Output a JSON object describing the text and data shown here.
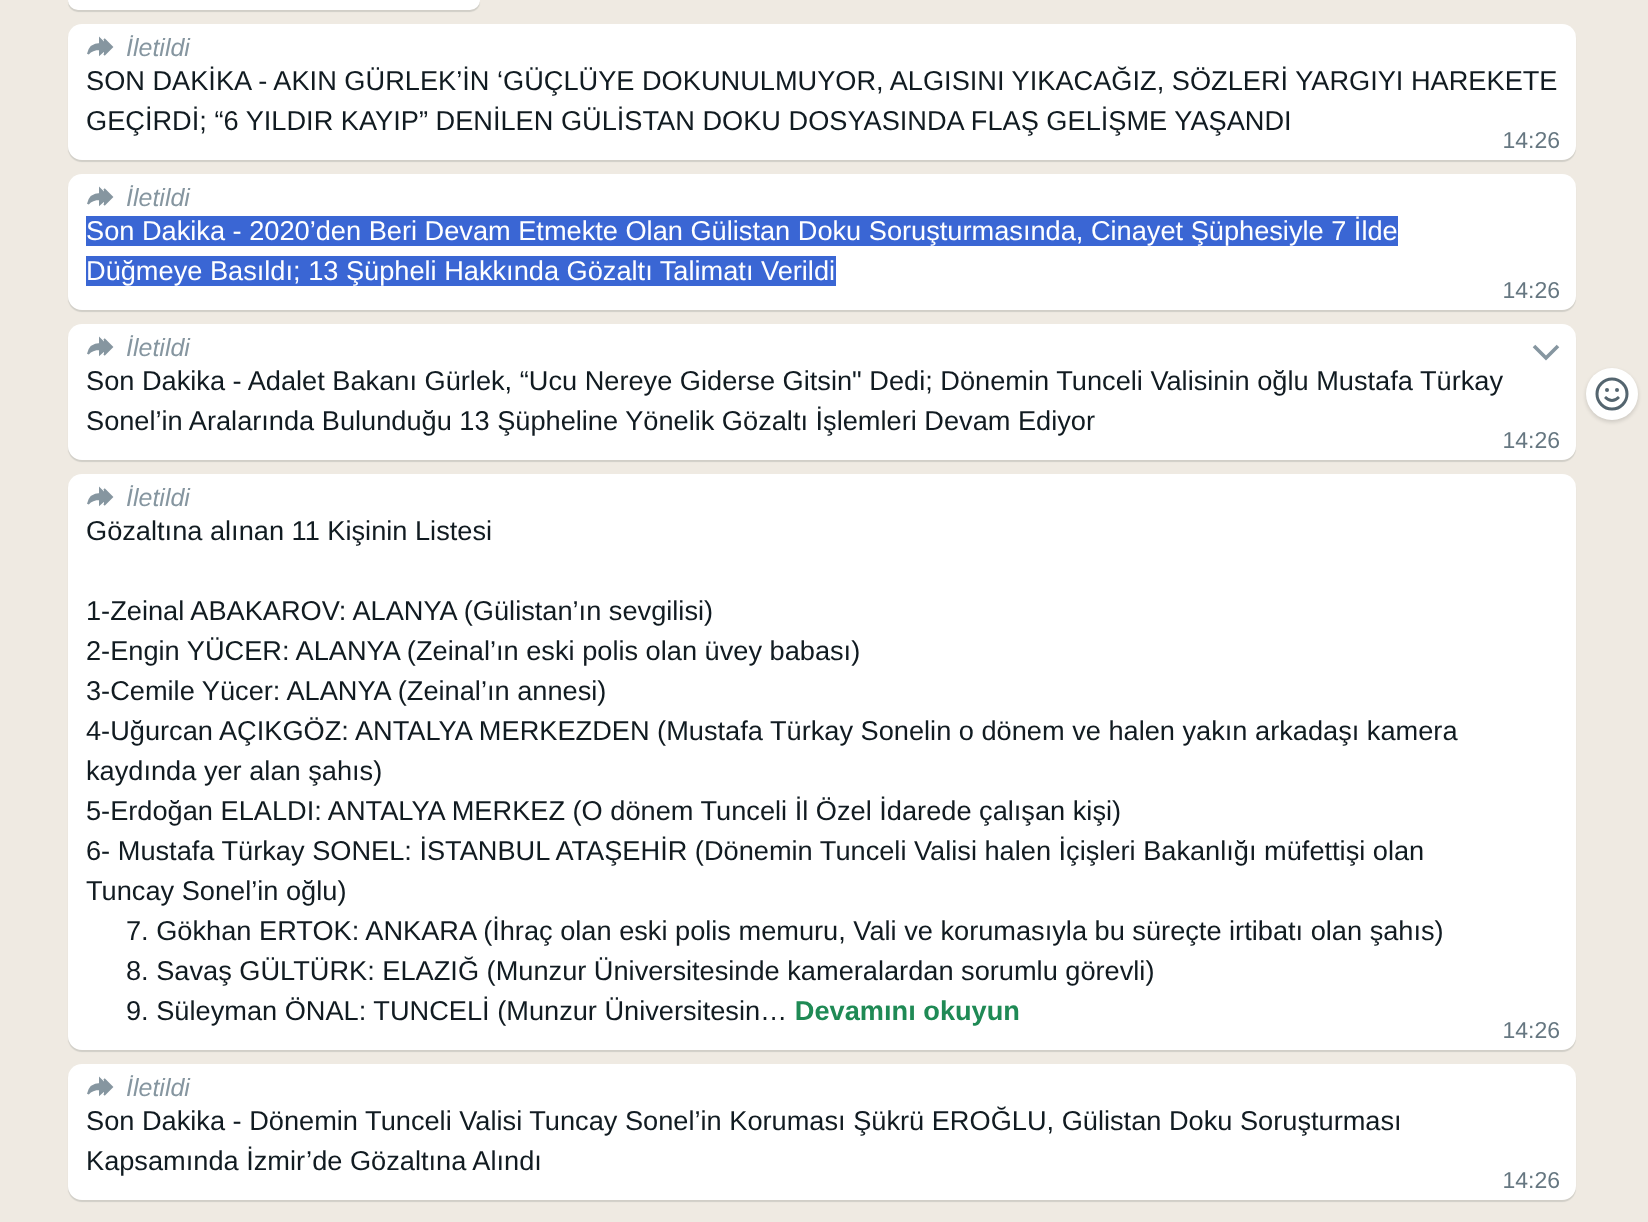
{
  "messages": [
    {
      "forwarded_label": "İletildi",
      "time": "14:26",
      "highlighted": false,
      "hovered": false,
      "lines": [
        {
          "kind": "plain",
          "text": "SON DAKİKA - AKIN GÜRLEK’İN ‘GÜÇLÜYE DOKUNULMUYOR, ALGISINI YIKACAĞIZ, SÖZLERİ YARGIYI HAREKETE"
        },
        {
          "kind": "plain",
          "text": "GEÇİRDİ; “6 YILDIR KAYIP” DENİLEN GÜLİSTAN DOKU DOSYASINDA FLAŞ GELİŞME YAŞANDI"
        }
      ]
    },
    {
      "forwarded_label": "İletildi",
      "time": "14:26",
      "highlighted": true,
      "hovered": false,
      "lines": [
        {
          "kind": "plain",
          "text": "Son Dakika - 2020’den Beri Devam Etmekte Olan Gülistan Doku Soruşturmasında, Cinayet Şüphesiyle 7 İlde"
        },
        {
          "kind": "plain",
          "text": "Düğmeye Basıldı; 13 Şüpheli Hakkında Gözaltı Talimatı Verildi"
        }
      ]
    },
    {
      "forwarded_label": "İletildi",
      "time": "14:26",
      "highlighted": false,
      "hovered": true,
      "lines": [
        {
          "kind": "plain",
          "text": "Son Dakika - Adalet Bakanı Gürlek, “Ucu Nereye Giderse Gitsin\" Dedi; Dönemin Tunceli Valisinin oğlu Mustafa Türkay"
        },
        {
          "kind": "plain",
          "text": "Sonel’in Aralarında Bulunduğu 13 Şüpheline Yönelik Gözaltı İşlemleri Devam Ediyor"
        }
      ]
    },
    {
      "forwarded_label": "İletildi",
      "time": "14:26",
      "highlighted": false,
      "hovered": false,
      "read_more": "Devamını okuyun",
      "lines": [
        {
          "kind": "plain",
          "text": "Gözaltına alınan 11 Kişinin Listesi"
        },
        {
          "kind": "gap"
        },
        {
          "kind": "plain",
          "text": "1-Zeinal ABAKAROV: ALANYA (Gülistan’ın sevgilisi)"
        },
        {
          "kind": "plain",
          "text": "2-Engin YÜCER: ALANYA (Zeinal’ın eski polis olan üvey babası)"
        },
        {
          "kind": "plain",
          "text": "3-Cemile Yücer: ALANYA (Zeinal’ın annesi)"
        },
        {
          "kind": "plain",
          "text": "4-Uğurcan AÇIKGÖZ: ANTALYA MERKEZDEN (Mustafa Türkay Sonelin o dönem ve halen yakın arkadaşı kamera"
        },
        {
          "kind": "plain",
          "text": "kaydında yer alan şahıs)"
        },
        {
          "kind": "plain",
          "text": "5-Erdoğan ELALDI: ANTALYA MERKEZ (O dönem Tunceli İl Özel İdarede çalışan kişi)"
        },
        {
          "kind": "plain",
          "text": "6- Mustafa Türkay SONEL: İSTANBUL ATAŞEHİR (Dönemin Tunceli Valisi halen İçişleri Bakanlığı müfettişi olan"
        },
        {
          "kind": "plain",
          "text": "Tuncay Sonel’in oğlu)"
        },
        {
          "kind": "indented",
          "text": "7. Gökhan ERTOK: ANKARA (İhraç olan eski polis memuru, Vali ve korumasıyla bu süreçte irtibatı olan şahıs)"
        },
        {
          "kind": "indented",
          "text": "8. Savaş GÜLTÜRK: ELAZIĞ (Munzur Üniversitesinde kameralardan sorumlu görevli)"
        },
        {
          "kind": "indented",
          "text": "9. Süleyman ÖNAL: TUNCELİ (Munzur Üniversitesin…"
        }
      ]
    },
    {
      "forwarded_label": "İletildi",
      "time": "14:26",
      "highlighted": false,
      "hovered": false,
      "lines": [
        {
          "kind": "plain",
          "text": "Son Dakika - Dönemin Tunceli Valisi Tuncay Sonel’in Koruması Şükrü EROĞLU, Gülistan Doku Soruşturması"
        },
        {
          "kind": "plain",
          "text": "Kapsamında İzmir’de Gözaltına Alındı"
        }
      ]
    }
  ]
}
